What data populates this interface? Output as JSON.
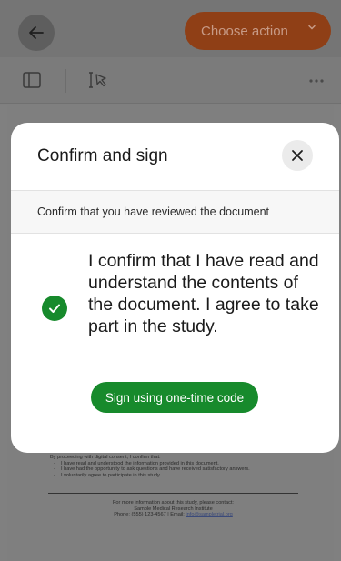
{
  "topbar": {
    "back_icon": "arrow-left-icon",
    "choose_action_label": "Choose action",
    "choose_action_icon": "chevron-down-icon",
    "colors": {
      "action_button": "#8f3f16"
    }
  },
  "toolbar": {
    "sidebar_icon": "sidebar-panel-icon",
    "select_icon": "text-cursor-select-icon",
    "more_icon": "more-horizontal-icon"
  },
  "document": {
    "consent_intro": "By proceeding with digital consent, I confirm that:",
    "consent_items": [
      "I have read and understood the information provided in this document.",
      "I have had the opportunity to ask questions and have received satisfactory answers.",
      "I voluntarily agree to participate in this study."
    ],
    "contact_line1": "For more information about this study, please contact:",
    "contact_line2": "Sample Medical Research Institute",
    "contact_phone_label": "Phone: (555) 123-4567 | Email: ",
    "contact_email": "info@sampletrial.org"
  },
  "modal": {
    "title": "Confirm and sign",
    "close_icon": "close-icon",
    "subtitle": "Confirm that you have reviewed the document",
    "check_icon": "check-circle-icon",
    "confirmation_text": "I confirm that I have read and understand the contents of the document. I agree to take part in the study.",
    "sign_button_label": "Sign using one-time code",
    "colors": {
      "accent_green": "#178a2c"
    }
  }
}
